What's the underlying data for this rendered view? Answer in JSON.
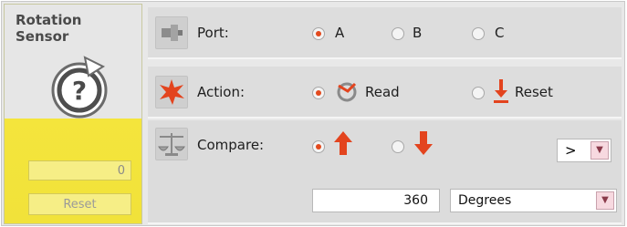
{
  "block": {
    "title_line1": "Rotation",
    "title_line2": "Sensor",
    "value": "0",
    "reset_label": "Reset"
  },
  "port": {
    "label": "Port:",
    "options": [
      "A",
      "B",
      "C"
    ],
    "selected": "A"
  },
  "action": {
    "label": "Action:",
    "options": [
      "Read",
      "Reset"
    ],
    "selected": "Read"
  },
  "compare": {
    "label": "Compare:",
    "direction_selected": "up",
    "operator": ">",
    "value": "360",
    "unit": "Degrees"
  },
  "colors": {
    "block_yellow": "#f4e53c",
    "radio_selected": "#e34a1e",
    "dropdown_arrow_bg": "#f7d9e0"
  }
}
